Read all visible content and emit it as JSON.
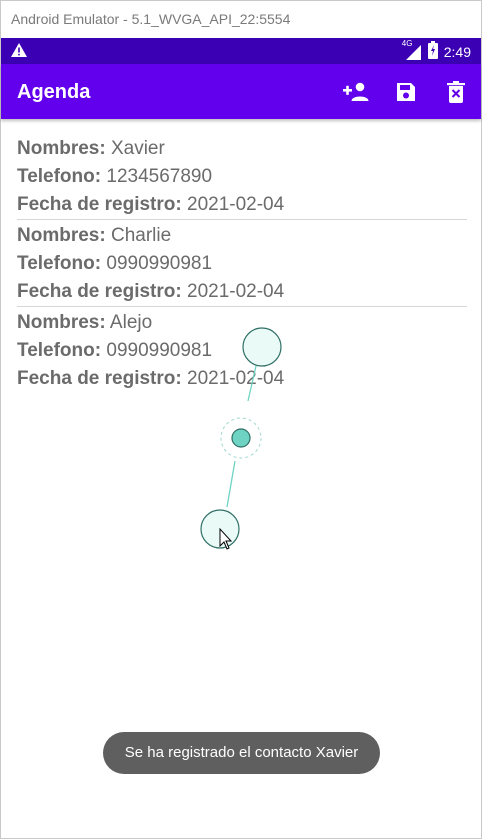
{
  "window": {
    "title": "Android Emulator - 5.1_WVGA_API_22:5554"
  },
  "status_bar": {
    "clock": "2:49",
    "network": "4G",
    "icons": [
      "warning-icon",
      "signal-icon",
      "battery-icon"
    ]
  },
  "app_bar": {
    "title": "Agenda",
    "actions": [
      {
        "name": "add-contact",
        "icon": "person-add-icon"
      },
      {
        "name": "save",
        "icon": "save-icon"
      },
      {
        "name": "delete",
        "icon": "delete-icon"
      }
    ]
  },
  "labels": {
    "name": "Nombres:",
    "phone": "Telefono:",
    "date": "Fecha de registro:"
  },
  "contacts": [
    {
      "name": "Xavier",
      "phone": "1234567890",
      "date": "2021-02-04"
    },
    {
      "name": "Charlie",
      "phone": "0990990981",
      "date": "2021-02-04"
    },
    {
      "name": "Alejo",
      "phone": "0990990981",
      "date": "2021-02-04"
    }
  ],
  "toast": {
    "message": "Se ha registrado el contacto Xavier"
  },
  "colors": {
    "status_bar": "#3b00b3",
    "app_bar": "#6200ee",
    "text": "#6b6b6b",
    "toast": "#5f5f5f",
    "gesture": "#6fd3c4"
  }
}
